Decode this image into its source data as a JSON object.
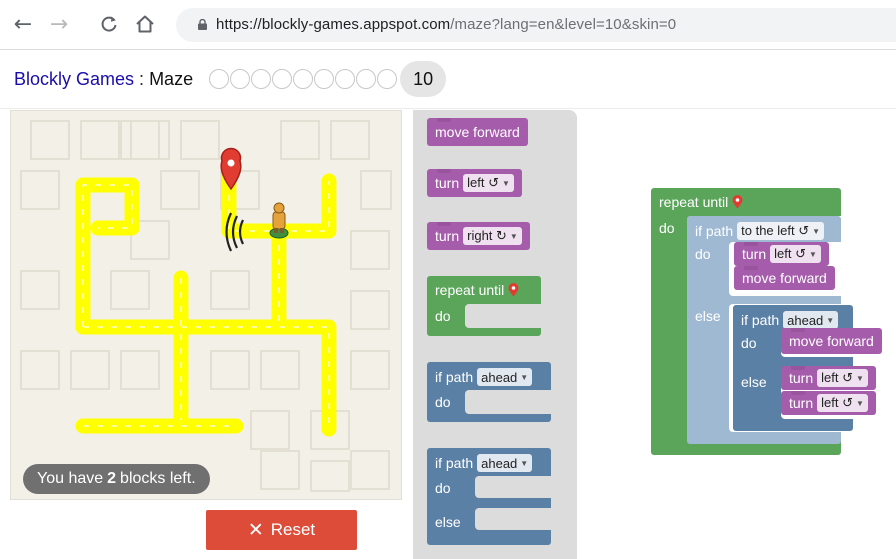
{
  "browser": {
    "back_icon": "←",
    "forward_icon": "→",
    "reload_icon": "C",
    "home_icon": "⌂",
    "url_host": "https://blockly-games.appspot.com",
    "url_rest": "/maze?lang=en&level=10&skin=0"
  },
  "header": {
    "app_link": "Blockly Games",
    "separator": ":",
    "page_title": "Maze",
    "level_dot_count": 9,
    "current_level": "10"
  },
  "maze": {
    "blocks_left_prefix": "You have",
    "blocks_left_count": "2",
    "blocks_left_suffix": "blocks left.",
    "reset_label": "Reset",
    "path_color": "#ffff00",
    "background_color": "#f3f0e7"
  },
  "toolbox": {
    "move_forward": "move forward",
    "turn_left_word": "turn",
    "turn_left_dir": "left ↺",
    "turn_right_word": "turn",
    "turn_right_dir": "right ↻",
    "repeat_until": "repeat until",
    "repeat_do": "do",
    "if_path": "if path",
    "if_dir": "ahead",
    "if_do": "do",
    "ifelse_path": "if path",
    "ifelse_dir": "ahead",
    "ifelse_do": "do",
    "ifelse_else": "else"
  },
  "workspace": {
    "repeat_until": "repeat until",
    "repeat_do": "do",
    "if_path": "if path",
    "if_dir": "to the left ↺",
    "if_do": "do",
    "turn_word": "turn",
    "turn_dir": "left ↺",
    "move_forward": "move forward",
    "else": "else",
    "inner_if_path": "if path",
    "inner_if_dir": "ahead",
    "inner_do": "do",
    "inner_move_forward": "move forward",
    "inner_else": "else",
    "inner_turn1_word": "turn",
    "inner_turn1_dir": "left ↺",
    "inner_turn2_word": "turn",
    "inner_turn2_dir": "left ↺"
  },
  "colors": {
    "purple": "#a55cab",
    "green": "#5ba55b",
    "blue": "#5b80a5",
    "light_blue": "#9fb9d3",
    "reset": "#dd4b39"
  }
}
